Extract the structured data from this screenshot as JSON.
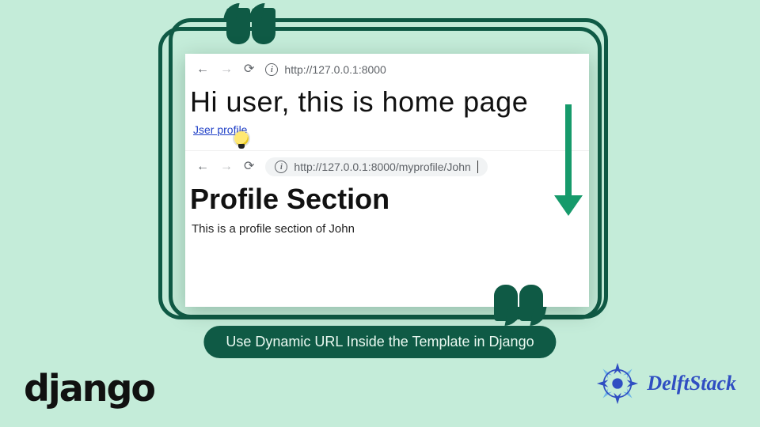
{
  "colors": {
    "brand_green": "#0f5a45",
    "accent_green": "#169a6b",
    "bg": "#c4ecd9",
    "delft_blue": "#2f4ec2"
  },
  "browser1": {
    "url": "http://127.0.0.1:8000",
    "heading": "Hi user, this is home page",
    "link_text": "Jser profile"
  },
  "browser2": {
    "url": "http://127.0.0.1:8000/myprofile/John",
    "heading": "Profile Section",
    "body": "This is a profile section of John"
  },
  "caption": "Use Dynamic URL Inside the Template in Django",
  "logos": {
    "django": "django",
    "delftstack": "DelftStack"
  }
}
